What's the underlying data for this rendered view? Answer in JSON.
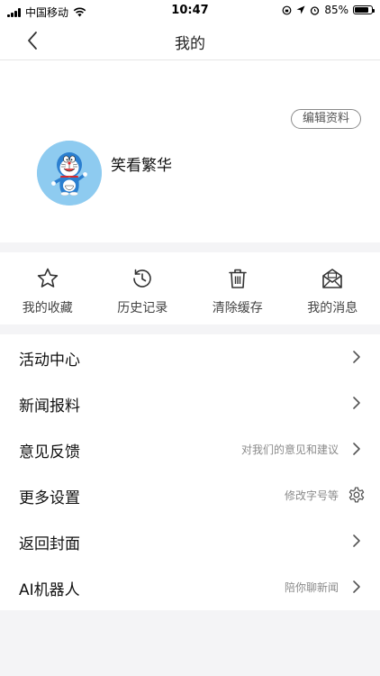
{
  "status": {
    "carrier": "中国移动",
    "time": "10:47",
    "battery_pct": "85%",
    "battery_level": 0.85
  },
  "nav": {
    "title": "我的",
    "back_icon": "chevron-left-icon"
  },
  "profile": {
    "edit_label": "编辑资料",
    "username": "笑看繁华",
    "avatar_color": "#8ecbf0"
  },
  "quick_actions": [
    {
      "label": "我的收藏",
      "icon": "star-icon"
    },
    {
      "label": "历史记录",
      "icon": "history-icon"
    },
    {
      "label": "清除缓存",
      "icon": "trash-icon"
    },
    {
      "label": "我的消息",
      "icon": "mail-icon"
    }
  ],
  "menu": [
    {
      "label": "活动中心",
      "hint": ""
    },
    {
      "label": "新闻报料",
      "hint": ""
    },
    {
      "label": "意见反馈",
      "hint": "对我们的意见和建议"
    },
    {
      "label": "更多设置",
      "hint": "修改字号等"
    },
    {
      "label": "返回封面",
      "hint": ""
    },
    {
      "label": "AI机器人",
      "hint": "陪你聊新闻"
    }
  ]
}
